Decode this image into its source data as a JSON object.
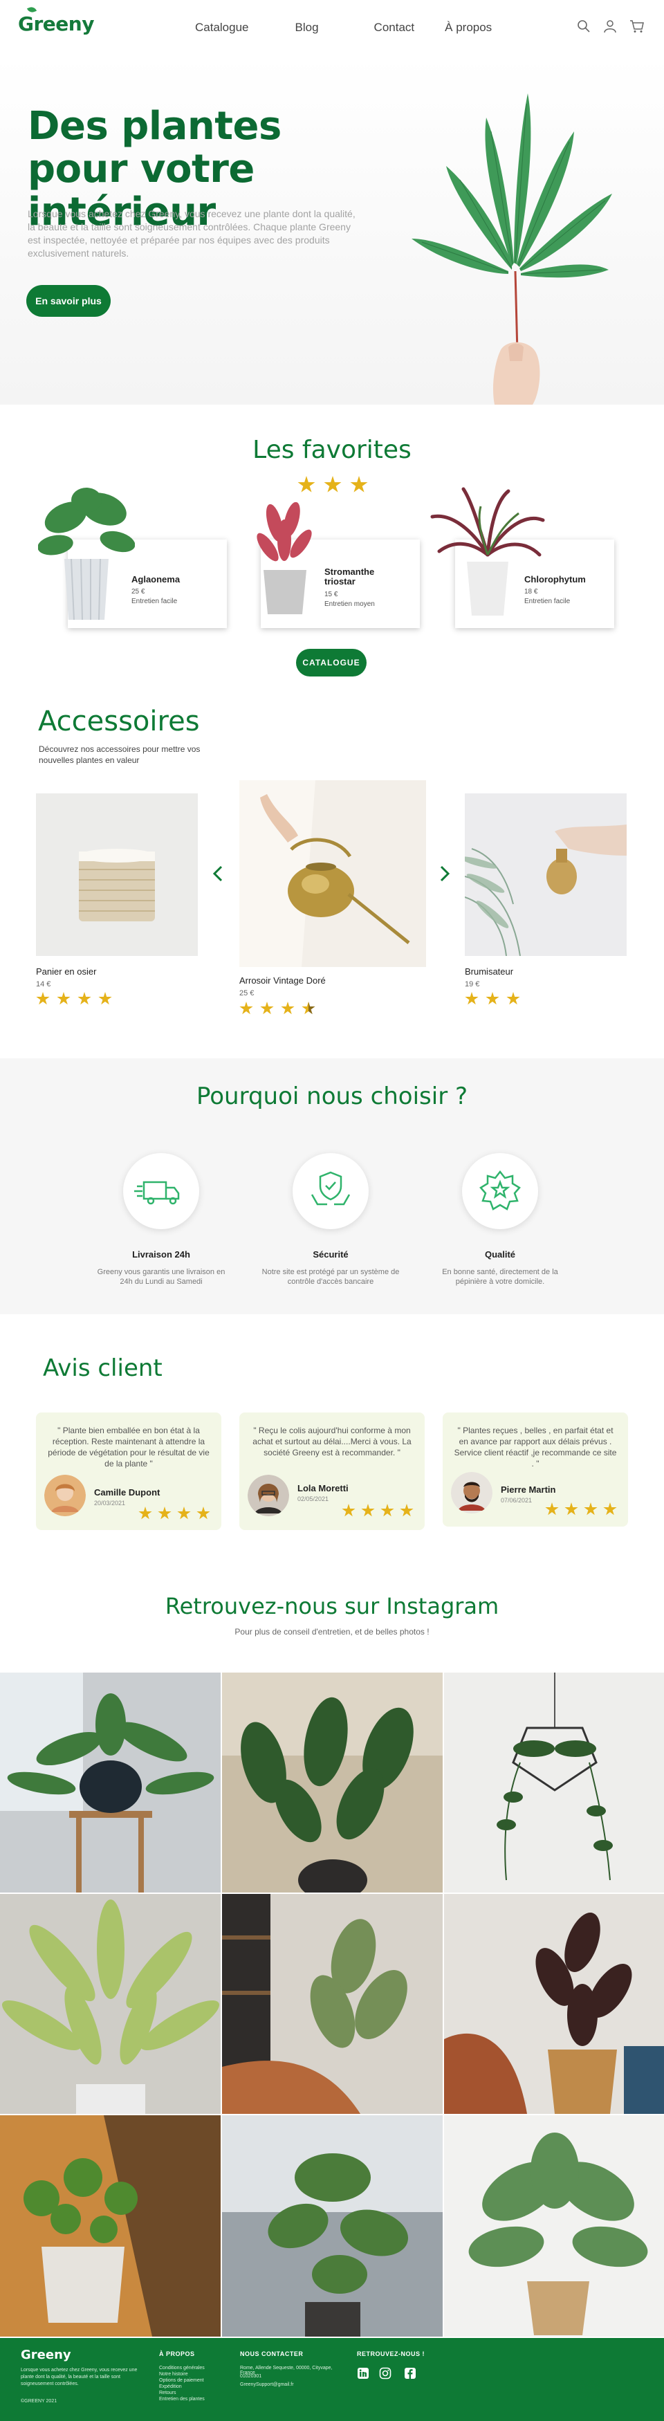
{
  "brand": {
    "name": "Greeny",
    "green": "#0e7a35",
    "star": "#e5b21a",
    "review_bg": "#f3f7e6"
  },
  "nav": {
    "links": [
      "Catalogue",
      "Blog",
      "Contact",
      "À propos"
    ],
    "icons": [
      "search-icon",
      "user-icon",
      "cart-icon"
    ]
  },
  "hero": {
    "title": "Des plantes pour votre intérieur",
    "text": "Lorsque vous achetez chez Greeny, vous recevez une plante dont la qualité, la beauté et la taille sont soigneusement contrôlées. Chaque plante Greeny est inspectée, nettoyée et préparée par nos équipes avec des produits exclusivement naturels.",
    "button": "En savoir plus"
  },
  "favorites": {
    "title": "Les favorites",
    "rating": 3,
    "products": [
      {
        "name": "Aglaonema",
        "price": "25 €",
        "care": "Entretien facile"
      },
      {
        "name": "Stromanthe triostar",
        "price": "15 €",
        "care": "Entretien moyen"
      },
      {
        "name": "Chlorophytum",
        "price": "18 €",
        "care": "Entretien facile"
      }
    ],
    "button": "CATALOGUE"
  },
  "accessories": {
    "title": "Accessoires",
    "subtitle": "Découvrez nos accessoires pour mettre vos nouvelles plantes en valeur",
    "items": [
      {
        "name": "Panier en osier",
        "price": "14 €",
        "rating": 4
      },
      {
        "name": "Arrosoir Vintage Doré",
        "price": "25 €",
        "rating": 3.5
      },
      {
        "name": "Brumisateur",
        "price": "19 €",
        "rating": 3
      }
    ],
    "prev_icon": "chevron-left-icon",
    "next_icon": "chevron-right-icon"
  },
  "why": {
    "title": "Pourquoi nous choisir ?",
    "features": [
      {
        "icon": "delivery-truck-icon",
        "name": "Livraison 24h",
        "desc": "Greeny vous garantis une livraison en 24h du Lundi au Samedi"
      },
      {
        "icon": "shield-hands-icon",
        "name": "Sécurité",
        "desc": "Notre site est protégé par un système de contrôle d'accès bancaire"
      },
      {
        "icon": "quality-badge-icon",
        "name": "Qualité",
        "desc": "En bonne santé, directement de la pépinière à votre domicile."
      }
    ]
  },
  "reviews": {
    "title": "Avis client",
    "items": [
      {
        "quote": "\" Plante bien emballée en bon état à la réception. Reste maintenant à attendre la période de végétation pour le résultat de vie de la plante \"",
        "name": "Camille Dupont",
        "date": "20/03/2021",
        "rating": 4
      },
      {
        "quote": "\" Reçu le colis aujourd'hui conforme à mon achat et surtout au délai....Merci à vous. La société Greeny est à recommander. \"",
        "name": "Lola Moretti",
        "date": "02/05/2021",
        "rating": 4
      },
      {
        "quote": "\" Plantes reçues , belles , en parfait état et en avance par rapport aux délais prévus . Service client réactif ,je recommande ce site . \"",
        "name": "Pierre Martin",
        "date": "07/06/2021",
        "rating": 4
      }
    ]
  },
  "instagram": {
    "title": "Retrouvez-nous sur Instagram",
    "subtitle": "Pour plus de conseil d'entretien, et de belles photos !"
  },
  "footer": {
    "logo": "Greeny",
    "desc": "Lorsque vous achetez chez Greeny, vous recevez une plante dont la qualité, la beauté et la taille sont soigneusement contrôlées.",
    "copyright": "©GREENY 2021",
    "about": {
      "title": "À PROPOS",
      "links": [
        "Conditions générales",
        "Notre histoire",
        "Options de paiement",
        "Expédition",
        "Retours",
        "Entretien des plantes"
      ]
    },
    "contact": {
      "title": "NOUS CONTACTER",
      "lines": [
        "Rome, Allende Sequeste, 00000, Cityvape, France",
        "01020301",
        "GreenySupport@gmail.fr"
      ]
    },
    "social": {
      "title": "RETROUVEZ-NOUS !",
      "icons": [
        "linkedin-icon",
        "instagram-icon",
        "facebook-icon"
      ]
    }
  }
}
